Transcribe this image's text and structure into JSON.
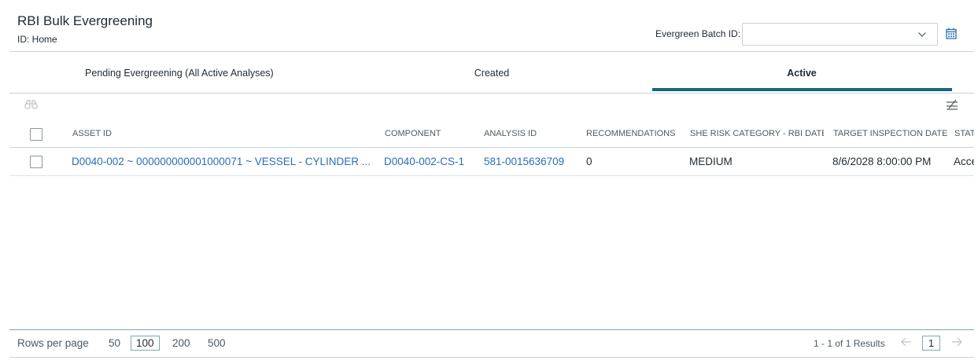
{
  "header": {
    "title": "RBI Bulk Evergreening",
    "subtitle": "ID: Home",
    "batch_label": "Evergreen Batch ID:",
    "batch_value": ""
  },
  "tabs": [
    {
      "label": "Pending Evergreening (All Active Analyses)"
    },
    {
      "label": "Created"
    },
    {
      "label": "Active"
    }
  ],
  "active_tab": "Active",
  "colors": {
    "accent": "#17677d",
    "link": "#2a6eb7",
    "border": "#c9d1d6"
  },
  "toolbar": {
    "left_icon": "binoculars-icon",
    "right_icon": "column-settings-icon"
  },
  "grid": {
    "columns": [
      "ASSET ID",
      "COMPONENT",
      "ANALYSIS ID",
      "RECOMMENDATIONS",
      "SHE RISK CATEGORY - RBI DATE",
      "TARGET INSPECTION DATE",
      "STAT"
    ],
    "rows": [
      {
        "asset_id": "D0040-002 ~ 000000000001000071 ~ VESSEL - CYLINDER ...",
        "component": "D0040-002-CS-1",
        "analysis_id": "581-0015636709",
        "recommendations": "0",
        "she_risk": "MEDIUM",
        "target_date": "8/6/2028 8:00:00 PM",
        "status": "Acce"
      }
    ]
  },
  "footer": {
    "rows_per_page_label": "Rows per page",
    "rows_options": [
      "50",
      "100",
      "200",
      "500"
    ],
    "selected_rows": "100",
    "results_text": "1 - 1 of 1 Results",
    "current_page": "1"
  }
}
